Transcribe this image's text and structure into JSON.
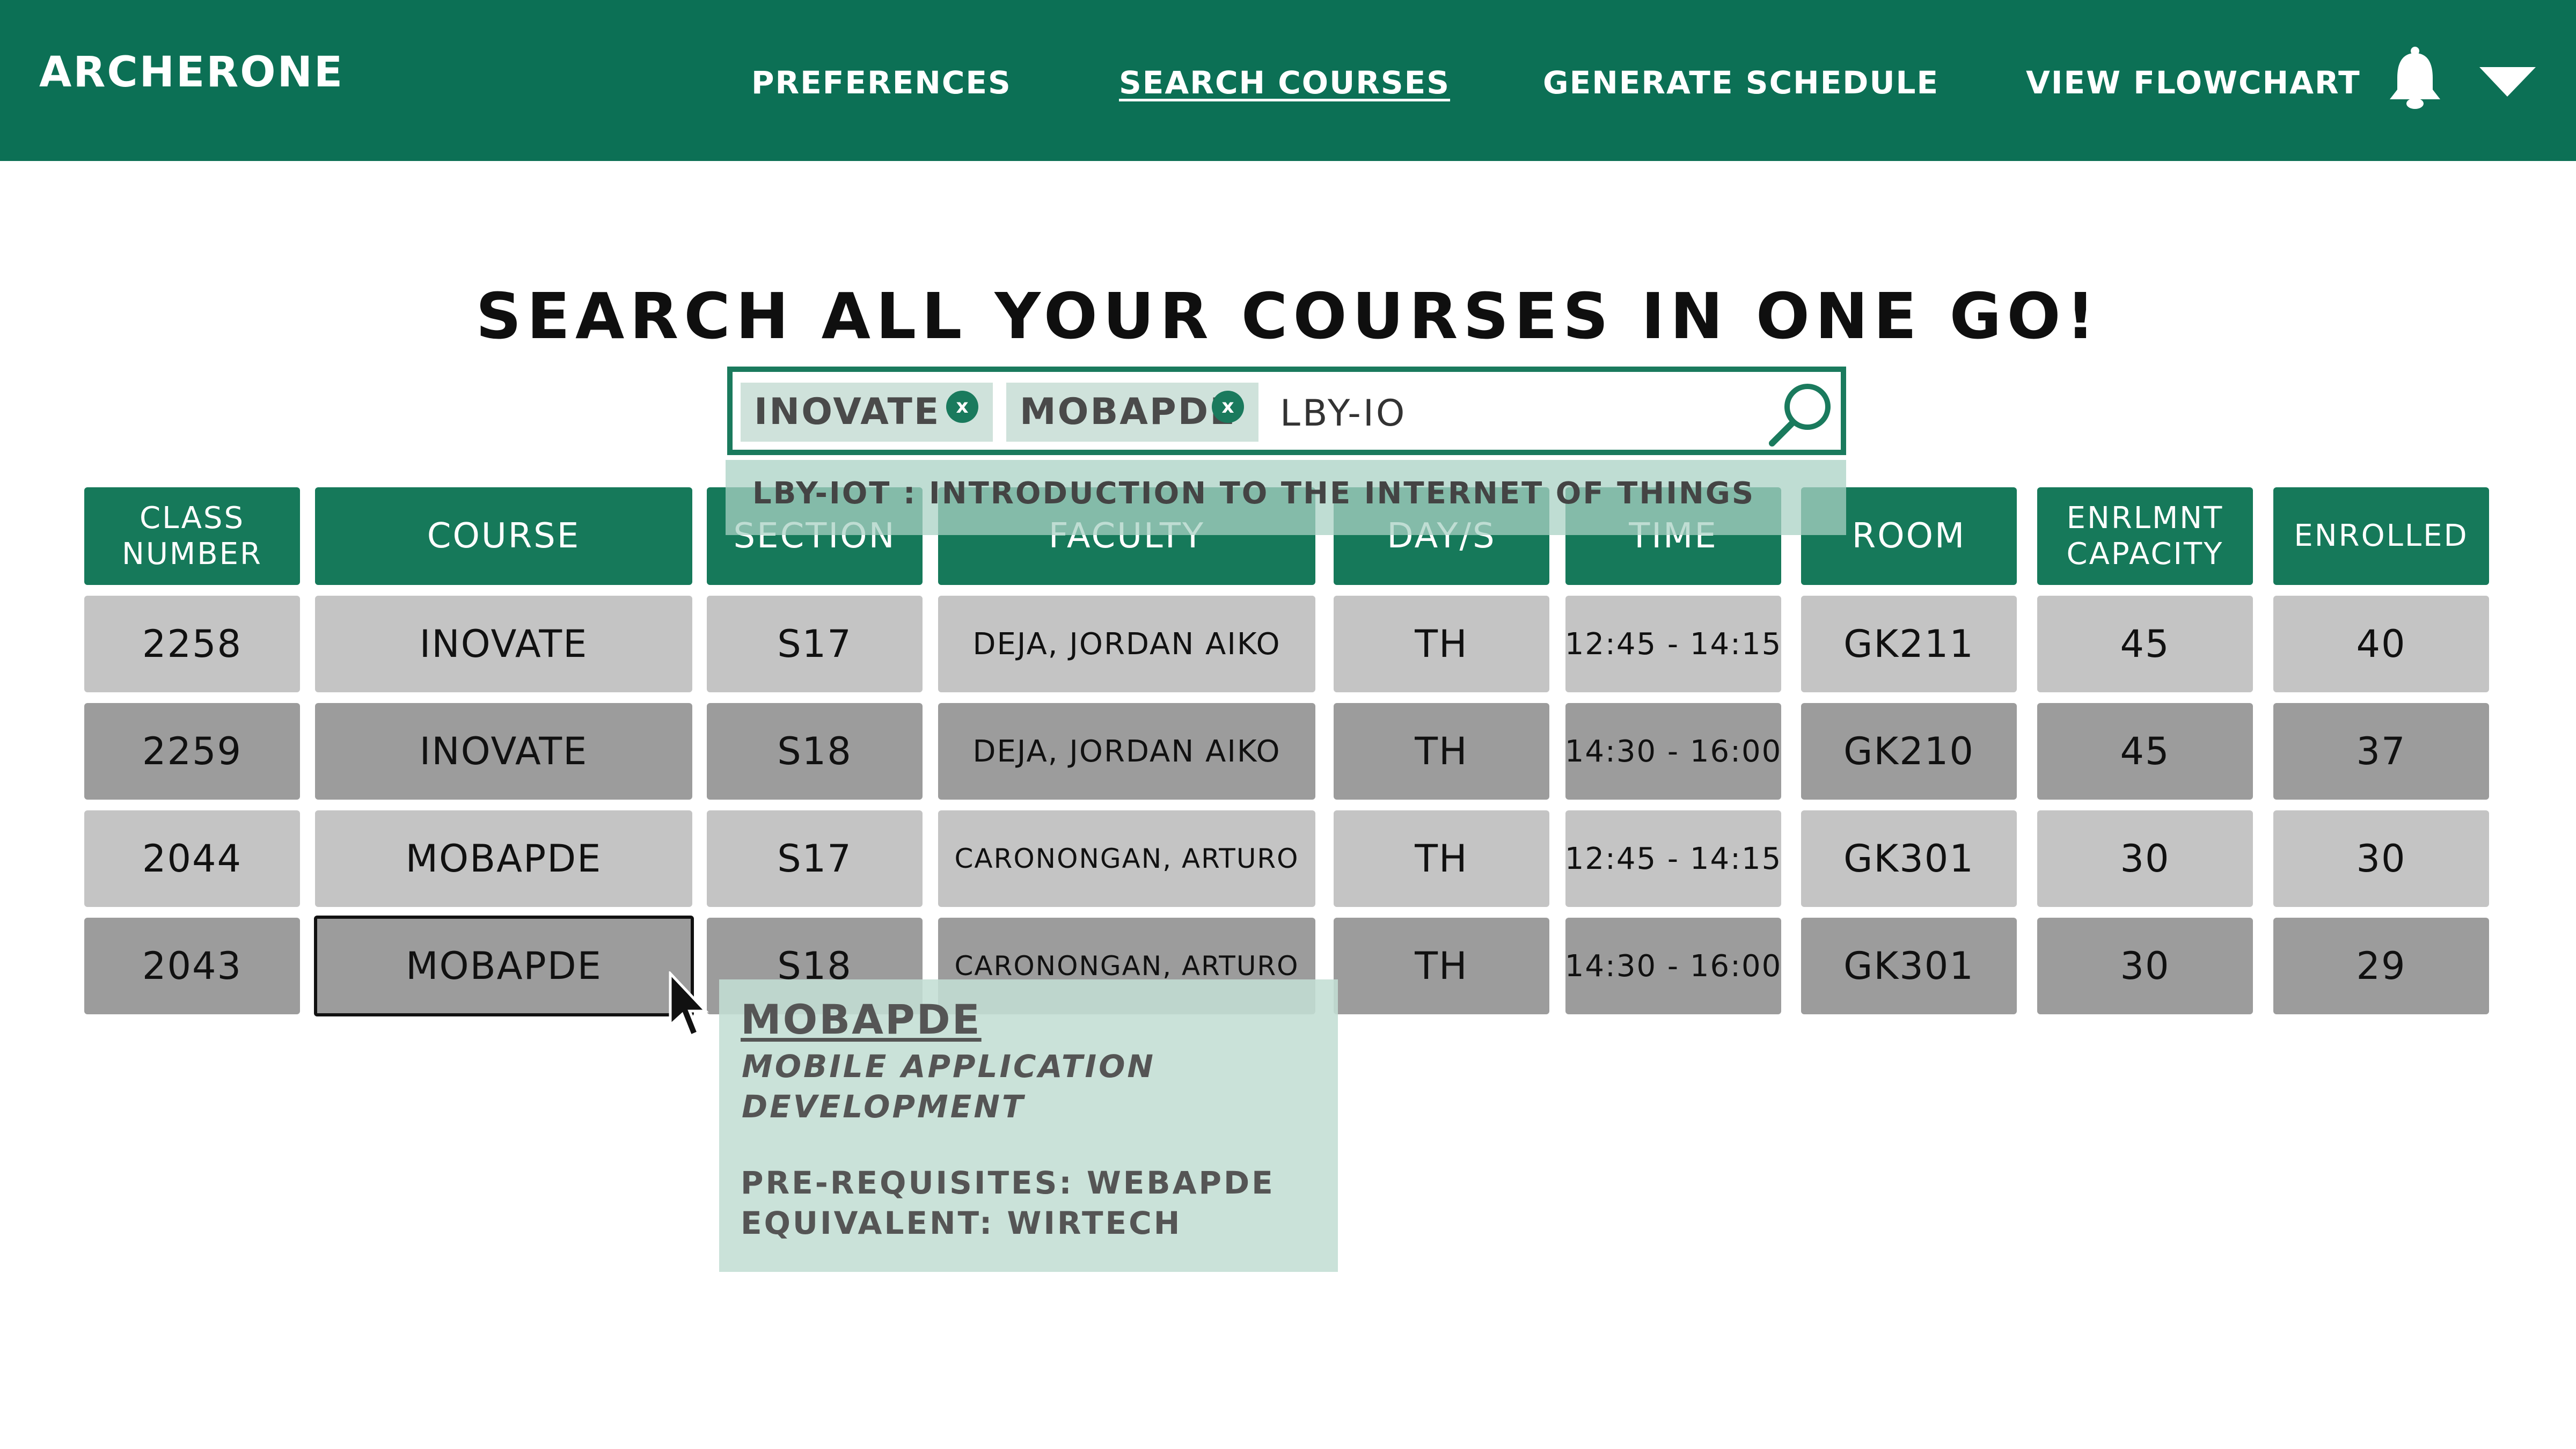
{
  "header": {
    "brand": "ARCHERONE",
    "nav": [
      "PREFERENCES",
      "SEARCH COURSES",
      "GENERATE SCHEDULE",
      "VIEW FLOWCHART"
    ],
    "active_nav": "SEARCH COURSES",
    "icons": [
      "bell-icon",
      "chevron-down-icon"
    ]
  },
  "headline": "SEARCH ALL YOUR COURSES IN ONE GO!",
  "search": {
    "chips": [
      "INOVATE",
      "MOBAPDE"
    ],
    "chip_remove_label": "x",
    "value": "LBY-IO",
    "suggestion": "LBY-IOT : INTRODUCTION TO THE INTERNET OF THINGS"
  },
  "table": {
    "headers": [
      "CLASS NUMBER",
      "COURSE",
      "SECTION",
      "FACULTY",
      "DAY/S",
      "TIME",
      "ROOM",
      "ENRLMNT CAPACITY",
      "ENROLLED"
    ],
    "rows": [
      [
        "2258",
        "INOVATE",
        "S17",
        "DEJA, JORDAN AIKO",
        "TH",
        "12:45 - 14:15",
        "GK211",
        "45",
        "40"
      ],
      [
        "2259",
        "INOVATE",
        "S18",
        "DEJA, JORDAN AIKO",
        "TH",
        "14:30 - 16:00",
        "GK210",
        "45",
        "37"
      ],
      [
        "2044",
        "MOBAPDE",
        "S17",
        "CARONONGAN, ARTURO",
        "TH",
        "12:45 - 14:15",
        "GK301",
        "30",
        "30"
      ],
      [
        "2043",
        "MOBAPDE",
        "S18",
        "CARONONGAN, ARTURO",
        "TH",
        "14:30 - 16:00",
        "GK301",
        "30",
        "29"
      ]
    ]
  },
  "tooltip": {
    "code": "MOBAPDE",
    "name": "MOBILE APPLICATION DEVELOPMENT",
    "prerequisites": "PRE-REQUISITES: WEBAPDE",
    "equivalent": "EQUIVALENT: WIRTECH"
  },
  "colors": {
    "primary": "#0c7055",
    "header_cell": "#16795a",
    "row_light": "#c4c4c4",
    "row_dark": "#9c9c9c",
    "tooltip_bg": "#c3ded4"
  }
}
